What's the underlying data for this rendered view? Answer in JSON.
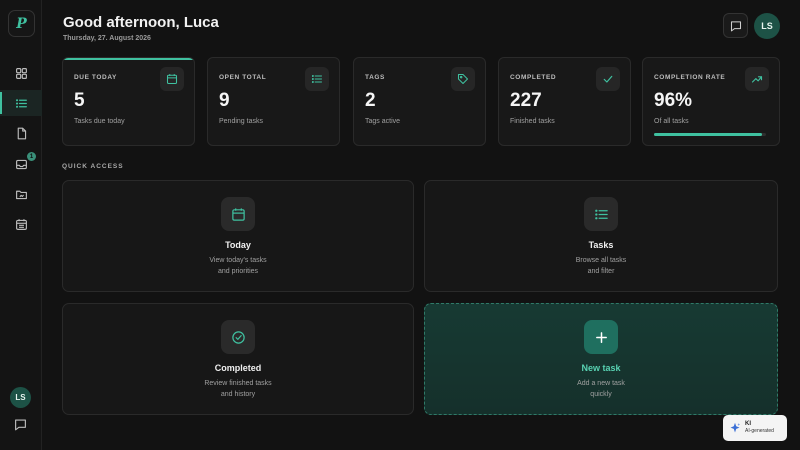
{
  "app": {
    "logo_letter": "P"
  },
  "sidebar": {
    "items": [
      {
        "name": "dashboard",
        "icon": "grid-icon",
        "active": false
      },
      {
        "name": "tasks",
        "icon": "list-icon",
        "active": true
      },
      {
        "name": "notes",
        "icon": "file-icon",
        "active": false
      },
      {
        "name": "inbox",
        "icon": "inbox-icon",
        "active": false,
        "badge": "1"
      },
      {
        "name": "projects",
        "icon": "folder-icon",
        "active": false
      },
      {
        "name": "calendar",
        "icon": "calendar-icon",
        "active": false
      }
    ],
    "user_initials": "LS"
  },
  "header": {
    "greeting": "Good afternoon, Luca",
    "date": "Thursday,  27.  August 2026",
    "user_initials": "LS"
  },
  "stats": [
    {
      "label": "DUE TODAY",
      "value": "5",
      "sub": "Tasks due today",
      "icon": "calendar-icon"
    },
    {
      "label": "OPEN TOTAL",
      "value": "9",
      "sub": "Pending tasks",
      "icon": "list-icon"
    },
    {
      "label": "TAGS",
      "value": "2",
      "sub": "Tags active",
      "icon": "tag-icon"
    },
    {
      "label": "COMPLETED",
      "value": "227",
      "sub": "Finished tasks",
      "icon": "check-icon"
    },
    {
      "label": "COMPLETION RATE",
      "value": "96%",
      "sub": "Of all tasks",
      "icon": "trending-up-icon",
      "progress": 0.96
    }
  ],
  "quick_access": {
    "title": "QUICK ACCESS",
    "cards": [
      {
        "name": "Today",
        "desc_line1": "View today's tasks",
        "desc_line2": "and priorities",
        "icon": "calendar-icon"
      },
      {
        "name": "Tasks",
        "desc_line1": "Browse all tasks",
        "desc_line2": "and filter",
        "icon": "list-icon"
      },
      {
        "name": "Completed",
        "desc_line1": "Review finished tasks",
        "desc_line2": "and history",
        "icon": "check-circle-icon"
      },
      {
        "name": "New task",
        "desc_line1": "Add a new task",
        "desc_line2": "quickly",
        "icon": "plus-icon"
      }
    ]
  },
  "ai_badge": {
    "line1": "KI",
    "line2": "AI-generated"
  },
  "colors": {
    "accent": "#3fc1a0",
    "background": "#121212",
    "card": "#181818"
  }
}
